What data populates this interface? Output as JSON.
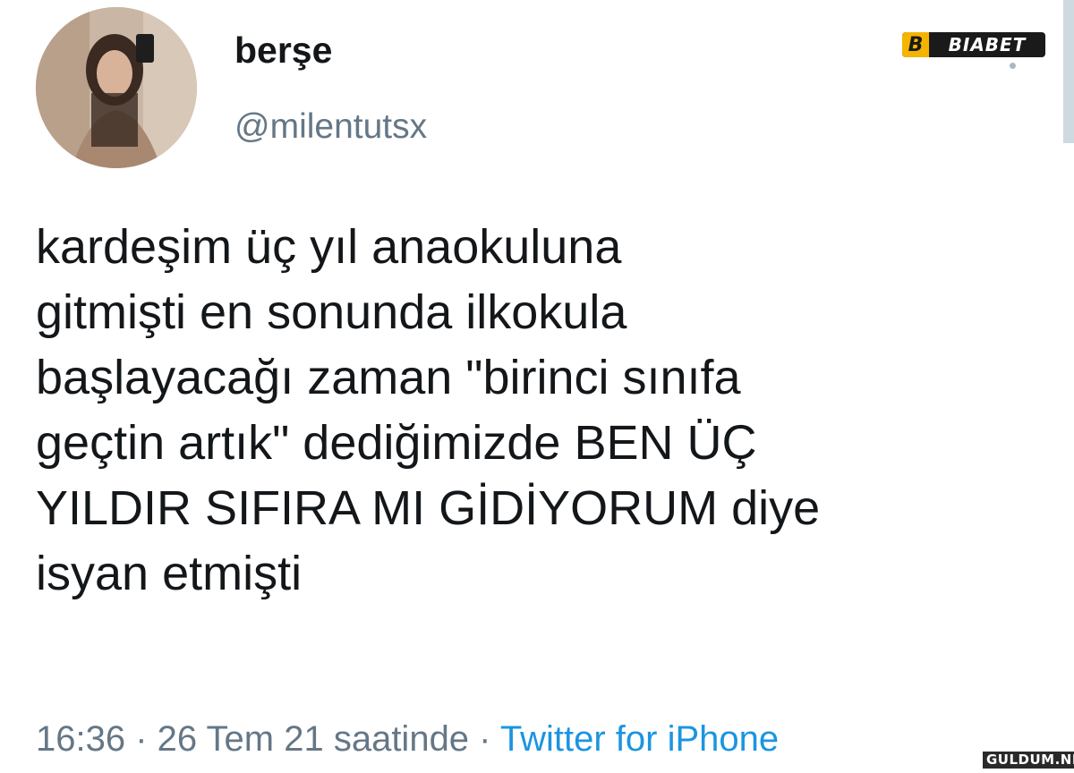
{
  "user": {
    "display_name": "berşe",
    "handle": "@milentutsx"
  },
  "tweet": {
    "lines": [
      "kardeşim üç yıl anaokuluna",
      "gitmişti en sonunda ilkokula",
      "başlayacağı zaman \"birinci sınıfa",
      "geçtin artık\" dediğimizde BEN ÜÇ",
      "YILDIR SIFIRA MI GİDİYORUM diye",
      "isyan etmişti"
    ]
  },
  "meta": {
    "time": "16:36",
    "separator": " · ",
    "date": "26 Tem 21 saatinde",
    "source": "Twitter for iPhone"
  },
  "watermarks": {
    "top_mark": "B",
    "top_text": "BIABET",
    "bottom_text": "GULDUM.NET"
  },
  "colors": {
    "text": "#14171a",
    "secondary": "#657786",
    "link": "#1b95e0"
  }
}
